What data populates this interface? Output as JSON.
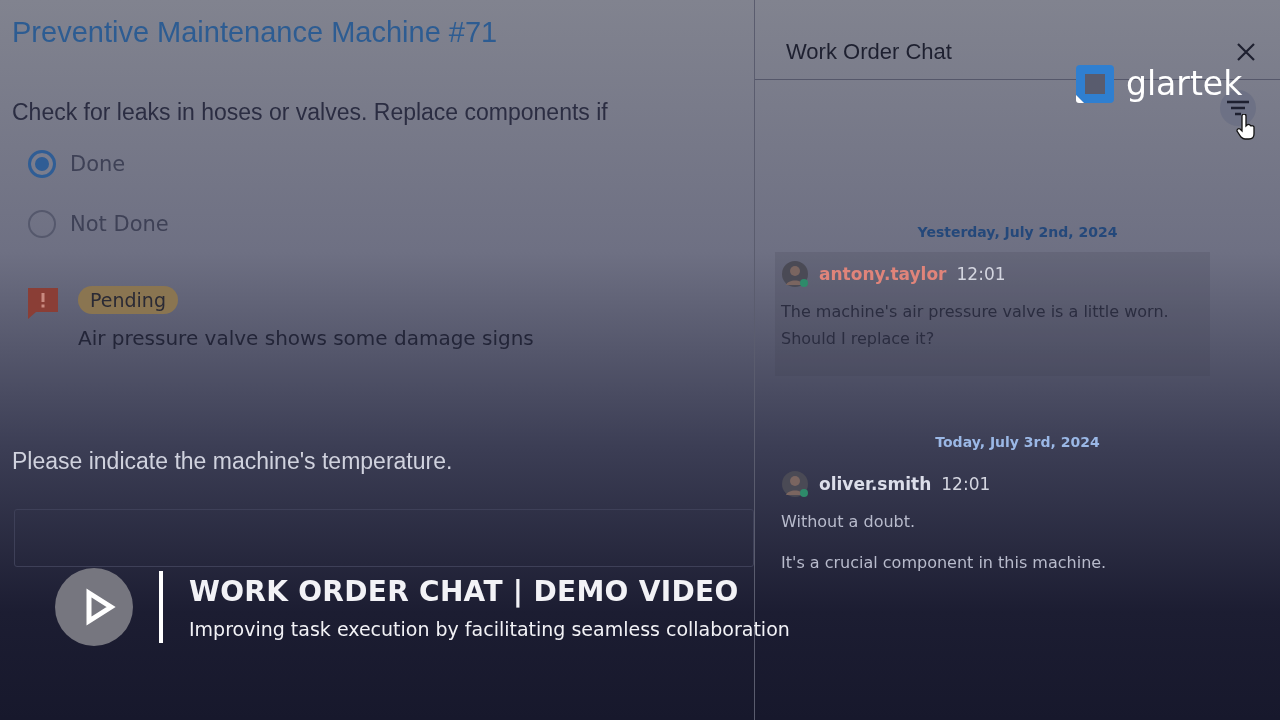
{
  "page": {
    "title": "Preventive Maintenance Machine #71",
    "question": "Check for leaks in hoses or valves. Replace components if",
    "options": [
      {
        "label": "Done",
        "selected": true
      },
      {
        "label": "Not Done",
        "selected": false
      }
    ],
    "issue": {
      "status": "Pending",
      "description": "Air pressure valve shows some damage signs"
    },
    "question_2": "Please indicate the machine's temperature."
  },
  "chat": {
    "title": "Work Order Chat",
    "groups": [
      {
        "date": "Yesterday, July 2nd, 2024",
        "messages": [
          {
            "author": "antony.taylor",
            "color": "#e0847a",
            "time": "12:01",
            "lines": [
              "The machine's air pressure valve is a little worn. Should I replace it?"
            ]
          }
        ]
      },
      {
        "date": "Today, July 3rd, 2024",
        "messages": [
          {
            "author": "oliver.smith",
            "color": "#dcdeea",
            "time": "12:01",
            "lines": [
              "Without a doubt.",
              "It's a crucial component in this machine."
            ]
          }
        ]
      }
    ]
  },
  "logo": {
    "name": "glartek"
  },
  "video": {
    "title": "WORK ORDER CHAT | DEMO VIDEO",
    "subtitle": "Improving task execution by facilitating seamless collaboration"
  }
}
